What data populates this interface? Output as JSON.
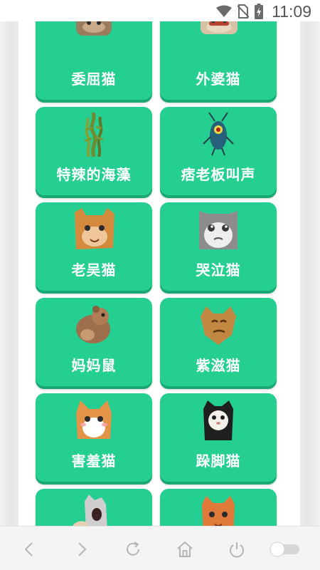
{
  "status_bar": {
    "time": "11:09",
    "icons": [
      "wifi-icon",
      "no-sim-icon",
      "battery-charging-icon"
    ]
  },
  "cards": [
    {
      "label": "委屈猫",
      "icon": "sad-cat-image"
    },
    {
      "label": "外婆猫",
      "icon": "grandma-cat-image"
    },
    {
      "label": "特辣的海藻",
      "icon": "seaweed-image"
    },
    {
      "label": "痞老板叫声",
      "icon": "plankton-image"
    },
    {
      "label": "老吴猫",
      "icon": "old-wu-cat-image"
    },
    {
      "label": "哭泣猫",
      "icon": "crying-cat-image"
    },
    {
      "label": "妈妈鼠",
      "icon": "mama-mouse-image"
    },
    {
      "label": "紫滋猫",
      "icon": "zizi-cat-image"
    },
    {
      "label": "害羞猫",
      "icon": "shy-cat-image"
    },
    {
      "label": "跺脚猫",
      "icon": "stomping-cat-image"
    },
    {
      "label": "",
      "icon": "screaming-cat-image"
    },
    {
      "label": "",
      "icon": "orange-cat-image"
    }
  ],
  "nav_bar": {
    "items": [
      "back-icon",
      "forward-icon",
      "refresh-icon",
      "home-icon",
      "power-icon",
      "toggle-switch"
    ]
  },
  "colors": {
    "card": "#25cf92",
    "card_shadow": "#17a874",
    "label": "#ffffff"
  }
}
